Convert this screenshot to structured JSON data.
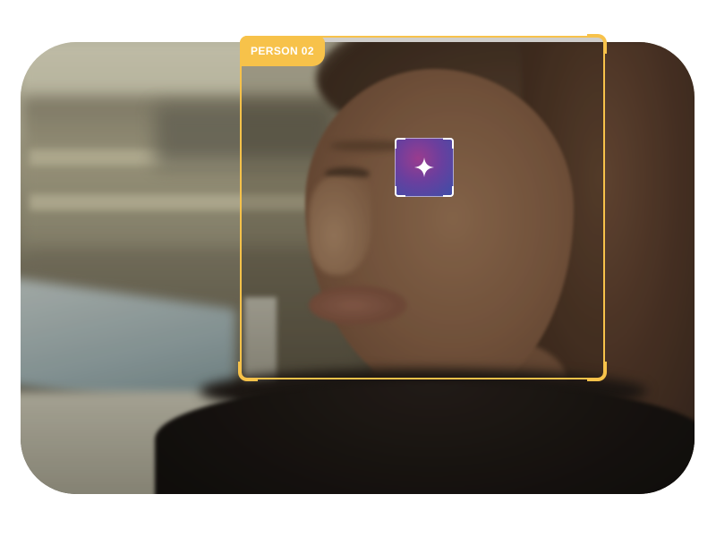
{
  "detection": {
    "label": "PERSON 02",
    "accent_color": "#f7c24a"
  },
  "ai_action": {
    "icon": "sparkle-icon",
    "gradient_colors": [
      "#9a3c8e",
      "#6a3f9e",
      "#3a4fa8"
    ]
  }
}
